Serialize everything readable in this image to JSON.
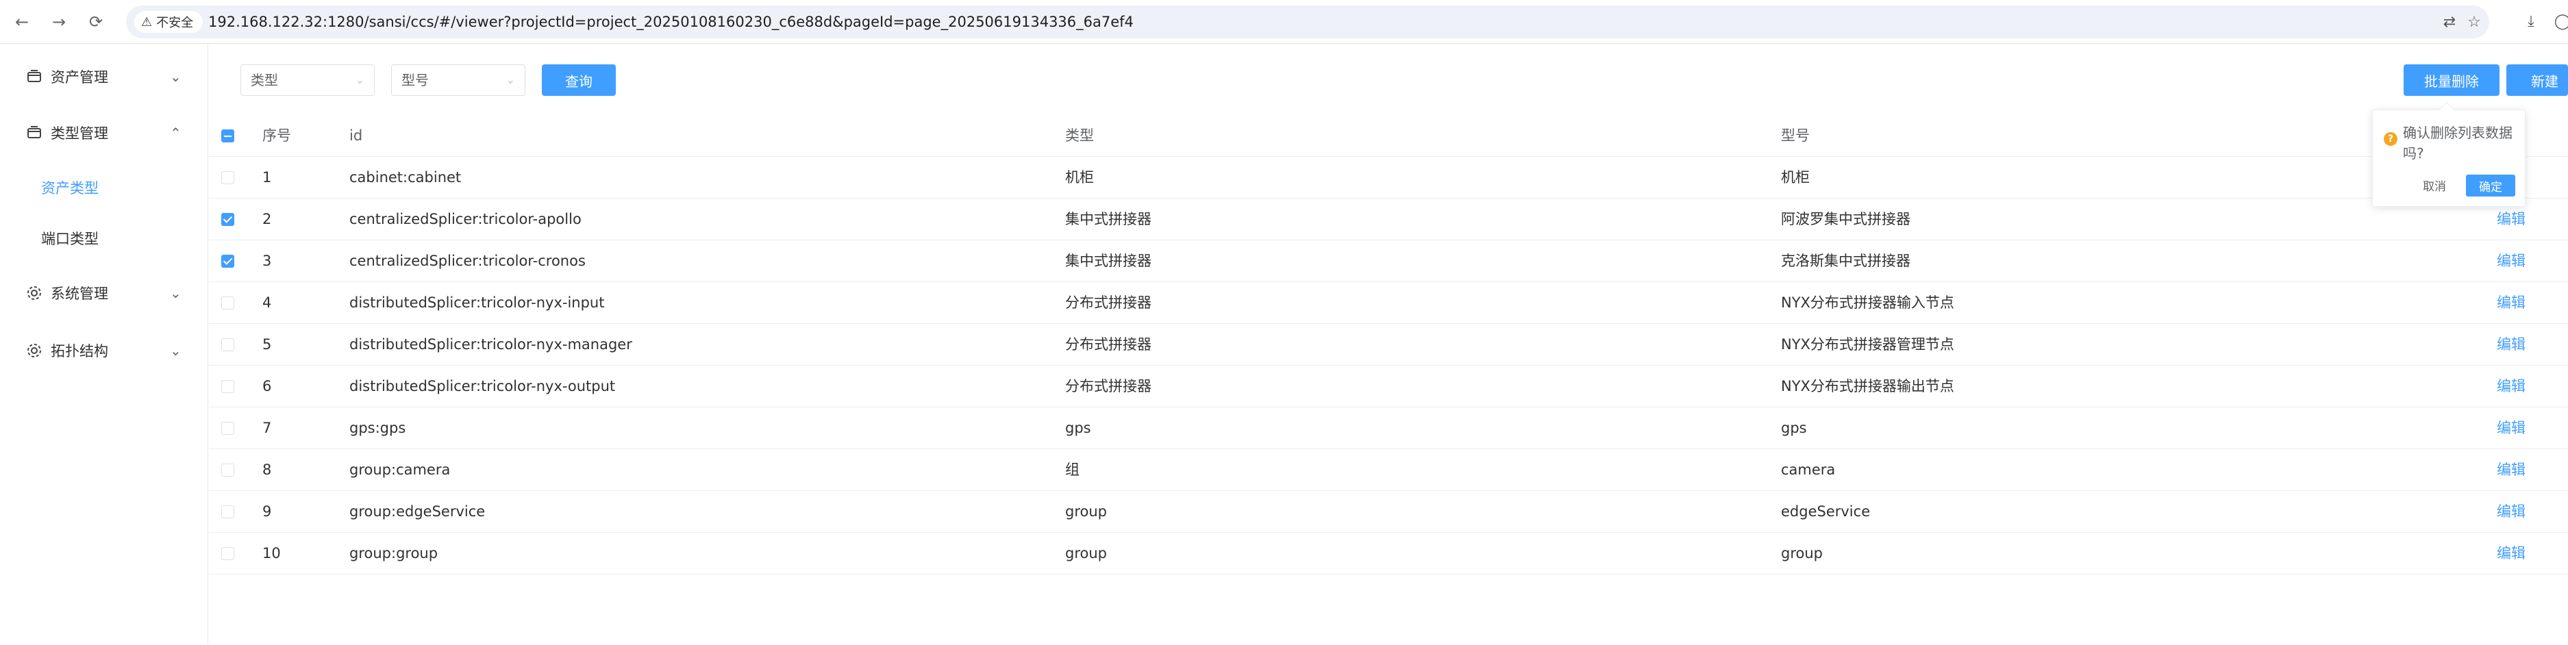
{
  "browser": {
    "security_label": "不安全",
    "url": "192.168.122.32:1280/sansi/ccs/#/viewer?projectId=project_20250108160230_c6e88d&pageId=page_20250619134336_6a7ef4"
  },
  "sidebar": {
    "items": [
      {
        "label": "资产管理",
        "icon": "archive-icon"
      },
      {
        "label": "类型管理",
        "icon": "archive-icon"
      },
      {
        "label": "系统管理",
        "icon": "gear-icon"
      },
      {
        "label": "拓扑结构",
        "icon": "gear-icon"
      }
    ],
    "sub_items": [
      {
        "label": "资产类型",
        "active": true
      },
      {
        "label": "端口类型",
        "active": false
      }
    ]
  },
  "toolbar": {
    "type_placeholder": "类型",
    "model_placeholder": "型号",
    "query_label": "查询",
    "batch_delete_label": "批量删除",
    "create_label": "新建"
  },
  "table": {
    "headers": {
      "index": "序号",
      "id": "id",
      "type": "类型",
      "model": "型号"
    },
    "rows": [
      {
        "index": "1",
        "id": "cabinet:cabinet",
        "type": "机柜",
        "model": "机柜",
        "checked": false,
        "action": ""
      },
      {
        "index": "2",
        "id": "centralizedSplicer:tricolor-apollo",
        "type": "集中式拼接器",
        "model": "阿波罗集中式拼接器",
        "checked": true,
        "action": "编辑"
      },
      {
        "index": "3",
        "id": "centralizedSplicer:tricolor-cronos",
        "type": "集中式拼接器",
        "model": "克洛斯集中式拼接器",
        "checked": true,
        "action": "编辑"
      },
      {
        "index": "4",
        "id": "distributedSplicer:tricolor-nyx-input",
        "type": "分布式拼接器",
        "model": "NYX分布式拼接器输入节点",
        "checked": false,
        "action": "编辑"
      },
      {
        "index": "5",
        "id": "distributedSplicer:tricolor-nyx-manager",
        "type": "分布式拼接器",
        "model": "NYX分布式拼接器管理节点",
        "checked": false,
        "action": "编辑"
      },
      {
        "index": "6",
        "id": "distributedSplicer:tricolor-nyx-output",
        "type": "分布式拼接器",
        "model": "NYX分布式拼接器输出节点",
        "checked": false,
        "action": "编辑"
      },
      {
        "index": "7",
        "id": "gps:gps",
        "type": "gps",
        "model": "gps",
        "checked": false,
        "action": "编辑"
      },
      {
        "index": "8",
        "id": "group:camera",
        "type": "组",
        "model": "camera",
        "checked": false,
        "action": "编辑"
      },
      {
        "index": "9",
        "id": "group:edgeService",
        "type": "group",
        "model": "edgeService",
        "checked": false,
        "action": "编辑"
      },
      {
        "index": "10",
        "id": "group:group",
        "type": "group",
        "model": "group",
        "checked": false,
        "action": "编辑"
      }
    ]
  },
  "popconfirm": {
    "message": "确认删除列表数据吗?",
    "cancel_label": "取消",
    "confirm_label": "确定"
  },
  "colors": {
    "primary": "#409eff",
    "warning": "#f5a623",
    "border": "#ebeef5"
  }
}
